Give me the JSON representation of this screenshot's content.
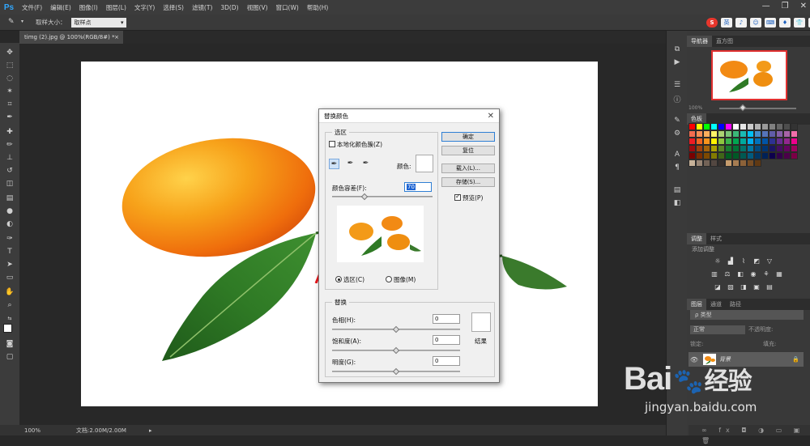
{
  "app": {
    "logo": "Ps"
  },
  "menubar": {
    "items": [
      "文件(F)",
      "编辑(E)",
      "图像(I)",
      "图层(L)",
      "文字(Y)",
      "选择(S)",
      "滤镜(T)",
      "3D(D)",
      "视图(V)",
      "窗口(W)",
      "帮助(H)"
    ],
    "window_controls": [
      "—",
      "❐",
      "✕"
    ]
  },
  "ime": {
    "logo": "S",
    "items": [
      "英",
      "♪",
      "☺",
      "⌨",
      "♦",
      "👕",
      "✂"
    ]
  },
  "options": {
    "label": "取样大小：",
    "select_value": "取样点"
  },
  "document_tab": {
    "title": "timg (2).jpg @ 100%(RGB/8#) *",
    "close": "×"
  },
  "statusbar": {
    "zoom": "100%",
    "doc_info": "文档:2.00M/2.00M",
    "arrow": "▸"
  },
  "panels": {
    "navigator_tabs": [
      "导航器",
      "直方图"
    ],
    "navigator_zoom": "100%",
    "swatch_tab": "色板",
    "adjust_tabs": [
      "调整",
      "样式"
    ],
    "adjust_title": "添加调整",
    "layers_tabs": [
      "图层",
      "通道",
      "路径"
    ],
    "layer_kind": "ρ 类型",
    "blend_mode": "正常",
    "opacity_label": "不透明度:",
    "lock_label": "锁定:",
    "fill_label": "填充:",
    "layer_name": "背景",
    "footer_icons": "∞ fx ◘ ◑ ▭ ▣ 🗑"
  },
  "dialog": {
    "title": "替换颜色",
    "close": "✕",
    "selection_group": "选区",
    "localized_clusters": "本地化颜色簇(Z)",
    "color_label": "颜色:",
    "tolerance_label": "颜色容差(F):",
    "tolerance_value": "70",
    "tolerance_level": 0.32,
    "radio_selection": "选区(C)",
    "radio_image": "图像(M)",
    "buttons": {
      "ok": "确定",
      "reset": "复位",
      "load": "载入(L)...",
      "save": "存储(S)..."
    },
    "preview_label": "预览(P)",
    "replace_group": "替换",
    "hue_label": "色相(H):",
    "hue_value": "0",
    "saturation_label": "饱和度(A):",
    "saturation_value": "0",
    "lightness_label": "明度(G):",
    "lightness_value": "0",
    "result_label": "结果"
  },
  "watermark": {
    "brand": "Bai",
    "brand_cn": "经验",
    "url": "jingyan.baidu.com"
  },
  "colors": {
    "accent_red": "#e8161b",
    "ps_blue": "#31a8ff",
    "fg_swatch": "#ffffff",
    "bg_swatch": "#22cc55"
  }
}
